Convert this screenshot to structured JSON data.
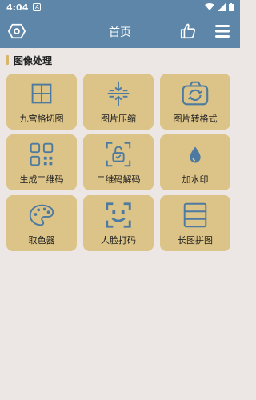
{
  "status_bar": {
    "time": "4:04",
    "notification_icon_letter": "A"
  },
  "app_bar": {
    "title": "首页",
    "left_icon": "settings-hexagon-icon",
    "like_icon": "thumbs-up-icon",
    "menu_icon": "hamburger-menu-icon"
  },
  "section": {
    "title": "图像处理"
  },
  "tools": [
    {
      "label": "九宫格切图",
      "icon": "grid-split-icon"
    },
    {
      "label": "图片压缩",
      "icon": "compress-icon"
    },
    {
      "label": "图片转格式",
      "icon": "camera-convert-icon"
    },
    {
      "label": "生成二维码",
      "icon": "qrcode-icon"
    },
    {
      "label": "二维码解码",
      "icon": "scan-unlock-icon"
    },
    {
      "label": "加水印",
      "icon": "water-drop-icon"
    },
    {
      "label": "取色器",
      "icon": "palette-icon"
    },
    {
      "label": "人脸打码",
      "icon": "face-scan-icon"
    },
    {
      "label": "长图拼图",
      "icon": "long-image-icon"
    }
  ],
  "colors": {
    "header": "#5d86a8",
    "tile": "#dcc387",
    "icon": "#4c7aa0",
    "accent": "#d7b56b",
    "background": "#ece7e5"
  }
}
